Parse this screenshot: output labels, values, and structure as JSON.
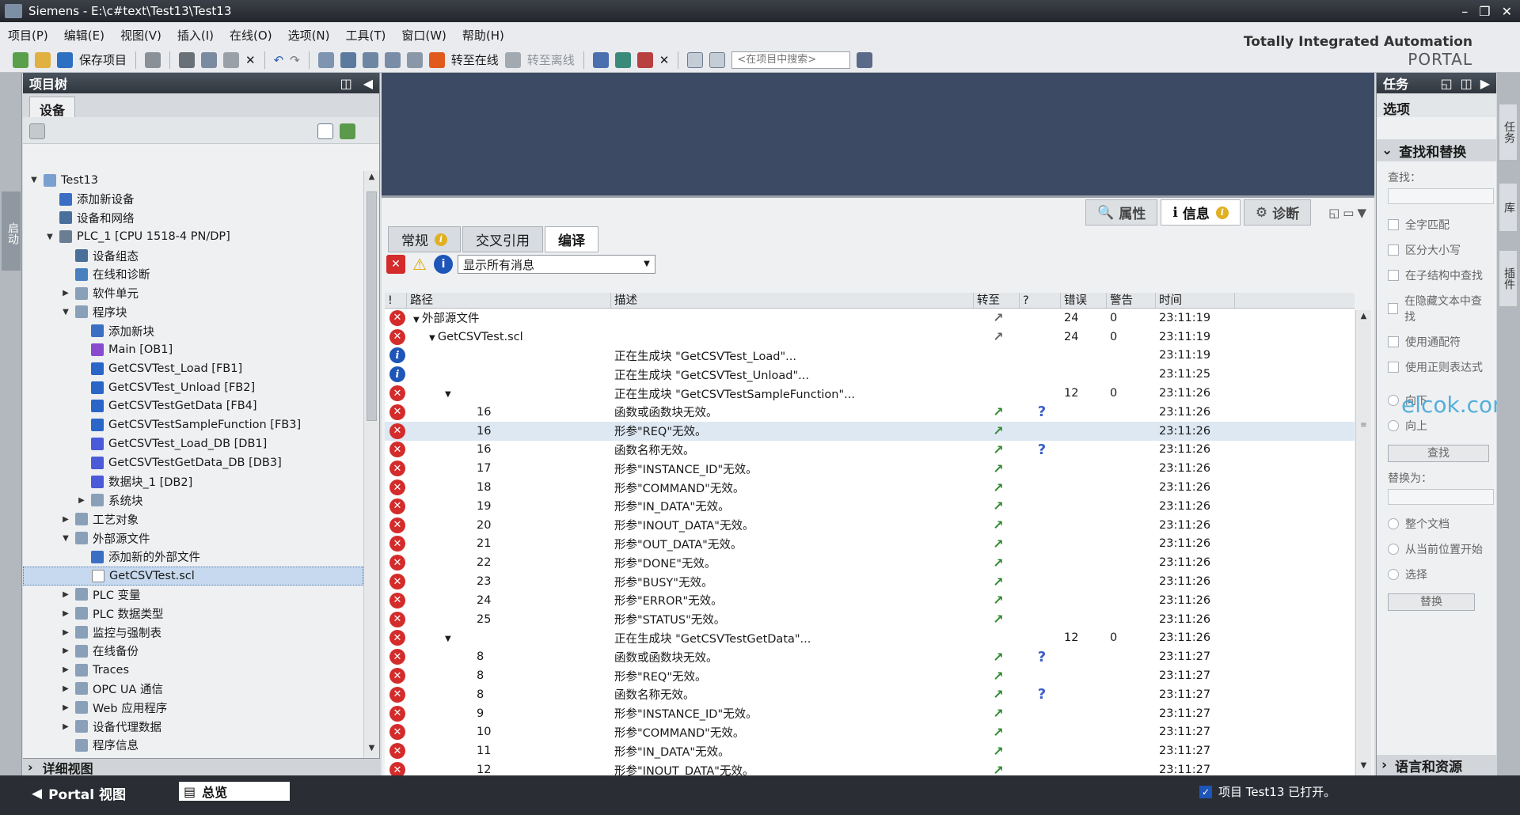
{
  "window": {
    "title": "Siemens  -  E:\\c#text\\Test13\\Test13"
  },
  "menu": [
    "项目(P)",
    "编辑(E)",
    "视图(V)",
    "插入(I)",
    "在线(O)",
    "选项(N)",
    "工具(T)",
    "窗口(W)",
    "帮助(H)"
  ],
  "toolbar": {
    "save_label": "保存项目",
    "go_online": "转至在线",
    "go_offline": "转至离线",
    "search_placeholder": "<在项目中搜索>"
  },
  "brand": {
    "line1": "Totally Integrated Automation",
    "line2": "PORTAL"
  },
  "left_strip": {
    "label": "启动"
  },
  "project_tree": {
    "title": "项目树",
    "tab": "设备",
    "items": [
      {
        "label": "Test13",
        "level": 0,
        "caret": "▼",
        "icon": "#7aa0d0"
      },
      {
        "label": "添加新设备",
        "level": 1,
        "caret": "",
        "icon": "#3a6fc4"
      },
      {
        "label": "设备和网络",
        "level": 1,
        "caret": "",
        "icon": "#4a6f9a"
      },
      {
        "label": "PLC_1 [CPU 1518-4 PN/DP]",
        "level": 1,
        "caret": "▼",
        "icon": "#6a7d92"
      },
      {
        "label": "设备组态",
        "level": 2,
        "caret": "",
        "icon": "#4a6f9a"
      },
      {
        "label": "在线和诊断",
        "level": 2,
        "caret": "",
        "icon": "#4a80c0"
      },
      {
        "label": "软件单元",
        "level": 2,
        "caret": "▶",
        "icon": "#8aa0b8"
      },
      {
        "label": "程序块",
        "level": 2,
        "caret": "▼",
        "icon": "#8aa0b8"
      },
      {
        "label": "添加新块",
        "level": 3,
        "caret": "",
        "icon": "#3a6fc4"
      },
      {
        "label": "Main [OB1]",
        "level": 3,
        "caret": "",
        "icon": "#8a4ad0"
      },
      {
        "label": "GetCSVTest_Load [FB1]",
        "level": 3,
        "caret": "",
        "icon": "#2a66c8"
      },
      {
        "label": "GetCSVTest_Unload [FB2]",
        "level": 3,
        "caret": "",
        "icon": "#2a66c8"
      },
      {
        "label": "GetCSVTestGetData [FB4]",
        "level": 3,
        "caret": "",
        "icon": "#2a66c8"
      },
      {
        "label": "GetCSVTestSampleFunction [FB3]",
        "level": 3,
        "caret": "",
        "icon": "#2a66c8"
      },
      {
        "label": "GetCSVTest_Load_DB [DB1]",
        "level": 3,
        "caret": "",
        "icon": "#4a5ad8"
      },
      {
        "label": "GetCSVTestGetData_DB [DB3]",
        "level": 3,
        "caret": "",
        "icon": "#4a5ad8"
      },
      {
        "label": "数据块_1 [DB2]",
        "level": 3,
        "caret": "",
        "icon": "#4a5ad8"
      },
      {
        "label": "系统块",
        "level": 3,
        "caret": "▶",
        "icon": "#8aa0b8"
      },
      {
        "label": "工艺对象",
        "level": 2,
        "caret": "▶",
        "icon": "#8aa0b8"
      },
      {
        "label": "外部源文件",
        "level": 2,
        "caret": "▼",
        "icon": "#8aa0b8"
      },
      {
        "label": "添加新的外部文件",
        "level": 3,
        "caret": "",
        "icon": "#3a6fc4"
      },
      {
        "label": "GetCSVTest.scl",
        "level": 3,
        "caret": "",
        "icon": "#ffffff",
        "selected": true
      },
      {
        "label": "PLC 变量",
        "level": 2,
        "caret": "▶",
        "icon": "#8aa0b8"
      },
      {
        "label": "PLC 数据类型",
        "level": 2,
        "caret": "▶",
        "icon": "#8aa0b8"
      },
      {
        "label": "监控与强制表",
        "level": 2,
        "caret": "▶",
        "icon": "#8aa0b8"
      },
      {
        "label": "在线备份",
        "level": 2,
        "caret": "▶",
        "icon": "#8aa0b8"
      },
      {
        "label": "Traces",
        "level": 2,
        "caret": "▶",
        "icon": "#8aa0b8"
      },
      {
        "label": "OPC UA 通信",
        "level": 2,
        "caret": "▶",
        "icon": "#8aa0b8"
      },
      {
        "label": "Web 应用程序",
        "level": 2,
        "caret": "▶",
        "icon": "#8aa0b8"
      },
      {
        "label": "设备代理数据",
        "level": 2,
        "caret": "▶",
        "icon": "#8aa0b8"
      },
      {
        "label": "程序信息",
        "level": 2,
        "caret": "",
        "icon": "#8aa0b8"
      }
    ],
    "detail_view": "详细视图"
  },
  "inspector": {
    "tabs": [
      "属性",
      "信息",
      "诊断"
    ],
    "subtabs": [
      "常规",
      "交叉引用",
      "编译"
    ],
    "filter": "显示所有消息",
    "columns": [
      "!",
      "路径",
      "描述",
      "转至",
      "?",
      "错误",
      "警告",
      "时间"
    ],
    "rows": [
      {
        "st": "err",
        "path": "外部源文件",
        "pcaret": "▼",
        "pindent": 0,
        "desc": "",
        "goto": "gray",
        "q": "",
        "err": "24",
        "warn": "0",
        "time": "23:11:19"
      },
      {
        "st": "err",
        "path": "GetCSVTest.scl",
        "pcaret": "▼",
        "pindent": 1,
        "desc": "",
        "goto": "gray",
        "q": "",
        "err": "24",
        "warn": "0",
        "time": "23:11:19"
      },
      {
        "st": "inf",
        "path": "",
        "pcaret": "",
        "pindent": 2,
        "desc": "正在生成块 \"GetCSVTest_Load\"...",
        "goto": "",
        "q": "",
        "err": "",
        "warn": "",
        "time": "23:11:19"
      },
      {
        "st": "inf",
        "path": "",
        "pcaret": "",
        "pindent": 2,
        "desc": "正在生成块 \"GetCSVTest_Unload\"...",
        "goto": "",
        "q": "",
        "err": "",
        "warn": "",
        "time": "23:11:25"
      },
      {
        "st": "err",
        "path": "",
        "pcaret": "▼",
        "pindent": 2,
        "desc": "正在生成块 \"GetCSVTestSampleFunction\"...",
        "goto": "",
        "q": "",
        "err": "12",
        "warn": "0",
        "time": "23:11:26"
      },
      {
        "st": "err",
        "path": "16",
        "pcaret": "",
        "pindent": 4,
        "desc": "函数或函数块无效。",
        "goto": "green",
        "q": "?",
        "err": "",
        "warn": "",
        "time": "23:11:26"
      },
      {
        "st": "err",
        "path": "16",
        "pcaret": "",
        "pindent": 4,
        "desc": "形参\"REQ\"无效。",
        "goto": "green",
        "q": "",
        "err": "",
        "warn": "",
        "time": "23:11:26",
        "hl": true
      },
      {
        "st": "err",
        "path": "16",
        "pcaret": "",
        "pindent": 4,
        "desc": "函数名称无效。",
        "goto": "green",
        "q": "?",
        "err": "",
        "warn": "",
        "time": "23:11:26"
      },
      {
        "st": "err",
        "path": "17",
        "pcaret": "",
        "pindent": 4,
        "desc": "形参\"INSTANCE_ID\"无效。",
        "goto": "green",
        "q": "",
        "err": "",
        "warn": "",
        "time": "23:11:26"
      },
      {
        "st": "err",
        "path": "18",
        "pcaret": "",
        "pindent": 4,
        "desc": "形参\"COMMAND\"无效。",
        "goto": "green",
        "q": "",
        "err": "",
        "warn": "",
        "time": "23:11:26"
      },
      {
        "st": "err",
        "path": "19",
        "pcaret": "",
        "pindent": 4,
        "desc": "形参\"IN_DATA\"无效。",
        "goto": "green",
        "q": "",
        "err": "",
        "warn": "",
        "time": "23:11:26"
      },
      {
        "st": "err",
        "path": "20",
        "pcaret": "",
        "pindent": 4,
        "desc": "形参\"INOUT_DATA\"无效。",
        "goto": "green",
        "q": "",
        "err": "",
        "warn": "",
        "time": "23:11:26"
      },
      {
        "st": "err",
        "path": "21",
        "pcaret": "",
        "pindent": 4,
        "desc": "形参\"OUT_DATA\"无效。",
        "goto": "green",
        "q": "",
        "err": "",
        "warn": "",
        "time": "23:11:26"
      },
      {
        "st": "err",
        "path": "22",
        "pcaret": "",
        "pindent": 4,
        "desc": "形参\"DONE\"无效。",
        "goto": "green",
        "q": "",
        "err": "",
        "warn": "",
        "time": "23:11:26"
      },
      {
        "st": "err",
        "path": "23",
        "pcaret": "",
        "pindent": 4,
        "desc": "形参\"BUSY\"无效。",
        "goto": "green",
        "q": "",
        "err": "",
        "warn": "",
        "time": "23:11:26"
      },
      {
        "st": "err",
        "path": "24",
        "pcaret": "",
        "pindent": 4,
        "desc": "形参\"ERROR\"无效。",
        "goto": "green",
        "q": "",
        "err": "",
        "warn": "",
        "time": "23:11:26"
      },
      {
        "st": "err",
        "path": "25",
        "pcaret": "",
        "pindent": 4,
        "desc": "形参\"STATUS\"无效。",
        "goto": "green",
        "q": "",
        "err": "",
        "warn": "",
        "time": "23:11:26"
      },
      {
        "st": "err",
        "path": "",
        "pcaret": "▼",
        "pindent": 2,
        "desc": "正在生成块 \"GetCSVTestGetData\"...",
        "goto": "",
        "q": "",
        "err": "12",
        "warn": "0",
        "time": "23:11:26"
      },
      {
        "st": "err",
        "path": "8",
        "pcaret": "",
        "pindent": 4,
        "desc": "函数或函数块无效。",
        "goto": "green",
        "q": "?",
        "err": "",
        "warn": "",
        "time": "23:11:27"
      },
      {
        "st": "err",
        "path": "8",
        "pcaret": "",
        "pindent": 4,
        "desc": "形参\"REQ\"无效。",
        "goto": "green",
        "q": "",
        "err": "",
        "warn": "",
        "time": "23:11:27"
      },
      {
        "st": "err",
        "path": "8",
        "pcaret": "",
        "pindent": 4,
        "desc": "函数名称无效。",
        "goto": "green",
        "q": "?",
        "err": "",
        "warn": "",
        "time": "23:11:27"
      },
      {
        "st": "err",
        "path": "9",
        "pcaret": "",
        "pindent": 4,
        "desc": "形参\"INSTANCE_ID\"无效。",
        "goto": "green",
        "q": "",
        "err": "",
        "warn": "",
        "time": "23:11:27"
      },
      {
        "st": "err",
        "path": "10",
        "pcaret": "",
        "pindent": 4,
        "desc": "形参\"COMMAND\"无效。",
        "goto": "green",
        "q": "",
        "err": "",
        "warn": "",
        "time": "23:11:27"
      },
      {
        "st": "err",
        "path": "11",
        "pcaret": "",
        "pindent": 4,
        "desc": "形参\"IN_DATA\"无效。",
        "goto": "green",
        "q": "",
        "err": "",
        "warn": "",
        "time": "23:11:27"
      },
      {
        "st": "err",
        "path": "12",
        "pcaret": "",
        "pindent": 4,
        "desc": "形参\"INOUT_DATA\"无效。",
        "goto": "green",
        "q": "",
        "err": "",
        "warn": "",
        "time": "23:11:27"
      }
    ]
  },
  "tasks": {
    "title": "任务",
    "options": "选项",
    "section": "查找和替换",
    "find_label": "查找：",
    "checks": [
      "全字匹配",
      "区分大小写",
      "在子结构中查找",
      "在隐藏文本中查找",
      "使用通配符",
      "使用正则表达式"
    ],
    "directions": [
      "向下",
      "向上"
    ],
    "find_button": "查找",
    "replace_label": "替换为：",
    "scopes": [
      "整个文档",
      "从当前位置开始",
      "选择"
    ],
    "replace_button": "替换",
    "lang": "语言和资源",
    "side_tabs": [
      "任务",
      "库",
      "插件"
    ],
    "watermark": "elcok.com"
  },
  "status": {
    "portal": "Portal 视图",
    "overview": "总览",
    "message": "项目 Test13 已打开。"
  }
}
